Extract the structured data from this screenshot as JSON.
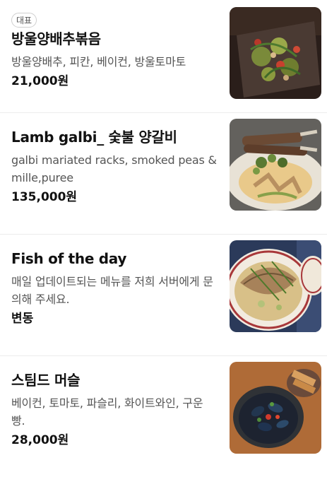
{
  "menu": {
    "items": [
      {
        "badge": "대표",
        "name": "방울양배추볶음",
        "description": "방울양배추, 피칸, 베이컨, 방울토마토",
        "price": "21,000원",
        "image_icon": "brussels-sprouts-dish-photo"
      },
      {
        "name": "Lamb galbi_ 숯불 양갈비",
        "description": "galbi mariated racks, smoked peas & mille,puree",
        "price": "135,000원",
        "image_icon": "lamb-galbi-dish-photo"
      },
      {
        "name": "Fish of the day",
        "description": "매일 업데이트되는 메뉴를 저희 서버에게 문의해 주세요.",
        "price": "변동",
        "image_icon": "fish-dish-photo"
      },
      {
        "name": "스팀드 머슬",
        "description": "베이컨, 토마토, 파슬리, 화이트와인, 구운 빵.",
        "price": "28,000원",
        "image_icon": "steamed-mussels-dish-photo"
      }
    ]
  }
}
